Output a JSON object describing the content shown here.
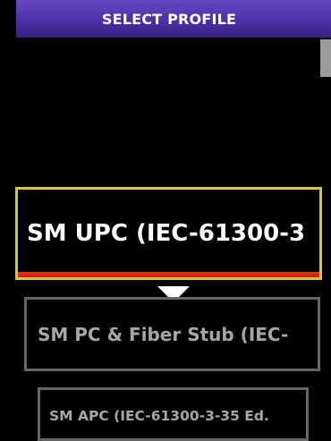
{
  "header": {
    "title": "SELECT PROFILE"
  },
  "profiles": [
    {
      "label": "SM UPC (IEC-61300-3",
      "selected": true
    },
    {
      "label": "SM PC & Fiber Stub (IEC-",
      "selected": false
    },
    {
      "label": "SM APC (IEC-61300-3-35 Ed.",
      "selected": false
    }
  ],
  "icons": {
    "selection_pointer": "triangle-down-icon"
  },
  "colors": {
    "header": "#4d2fa8",
    "selected_border": "#d8c43a",
    "selected_underline": "#e33b1a",
    "unselected_border": "#666666",
    "unselected_text": "#a6a6a6"
  }
}
